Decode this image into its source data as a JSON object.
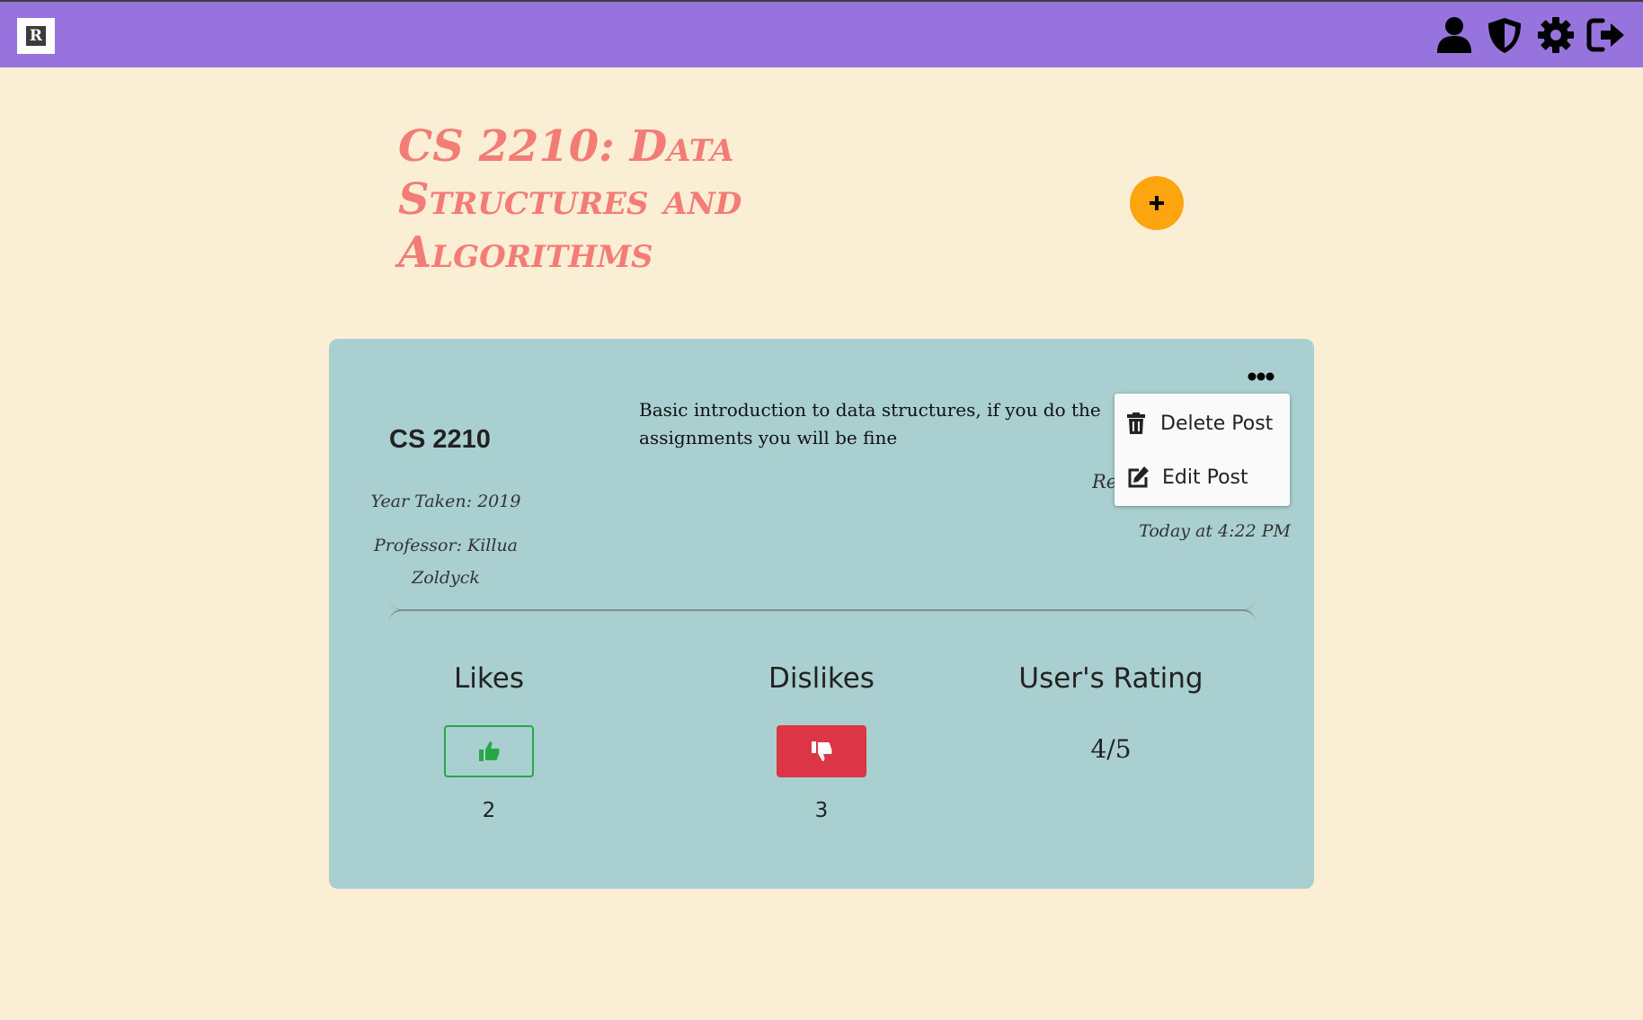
{
  "navbar": {
    "logo_letter": "R",
    "background": "#9673dd",
    "icons": [
      "user-icon",
      "shield-icon",
      "gear-icon",
      "sign-out-icon"
    ]
  },
  "course": {
    "title": "CS 2210: Data Structures and Algorithms",
    "title_color": "#f47c76"
  },
  "add_button": {
    "symbol": "+",
    "color": "#fda50f"
  },
  "post": {
    "course_code": "CS 2210",
    "year_taken": "Year Taken: 2019",
    "professor": "Professor: Killua Zoldyck",
    "description": "Basic introduction to data structures, if you do the assignments you will be fine",
    "rating_label_partial": "Re",
    "timestamp": "Today at 4:22 PM",
    "card_color": "#a9cfd0"
  },
  "menu": {
    "delete_label": "Delete Post",
    "edit_label": "Edit Post"
  },
  "stats": {
    "likes_label": "Likes",
    "likes_count": "2",
    "dislikes_label": "Dislikes",
    "dislikes_count": "3",
    "rating_label": "User's Rating",
    "rating_value": "4/5",
    "like_color": "#28a745",
    "dislike_color": "#dc3545"
  }
}
